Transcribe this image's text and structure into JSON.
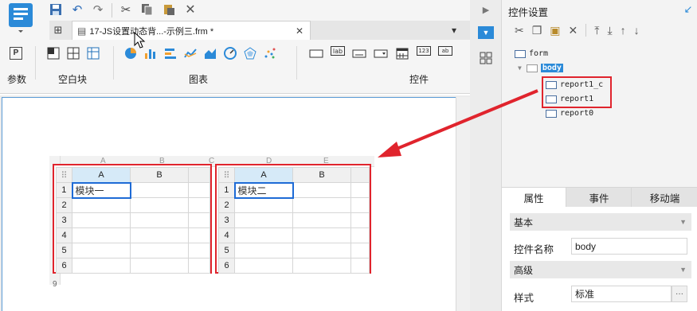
{
  "toolbar": {
    "tab_title": "17-JS设置动态背...-示例三.frm *",
    "groups": {
      "params": "参数",
      "blank": "空白块",
      "charts": "图表",
      "widgets": "控件"
    },
    "param_glyph": "P",
    "widget_glyph_lab": "lab",
    "widget_glyph_123": "123",
    "widget_glyph_ab": "ab"
  },
  "sheet_left": {
    "columns": [
      "A",
      "B"
    ],
    "rows": [
      "1",
      "2",
      "3",
      "4",
      "5",
      "6"
    ],
    "a1": "模块一"
  },
  "sheet_right": {
    "columns": [
      "A",
      "B"
    ],
    "rows": [
      "1",
      "2",
      "3",
      "4",
      "5",
      "6"
    ],
    "a1": "模块二"
  },
  "bg_columns": [
    "A",
    "B",
    "C",
    "D",
    "E"
  ],
  "bg_last_row": "9",
  "panel": {
    "title": "控件设置",
    "tree": {
      "form": "form",
      "body": "body",
      "report1_c": "report1_c",
      "report1": "report1",
      "report0": "report0"
    },
    "tabs": [
      "属性",
      "事件",
      "移动端"
    ],
    "section_basic": "基本",
    "label_name": "控件名称",
    "value_name": "body",
    "section_advanced": "高级",
    "label_style": "样式",
    "value_style": "标准",
    "more_glyph": "···"
  },
  "colors": {
    "highlight_red": "#e0242d",
    "accent_blue": "#2b8ad8",
    "selection_blue": "#1e6bd6"
  }
}
